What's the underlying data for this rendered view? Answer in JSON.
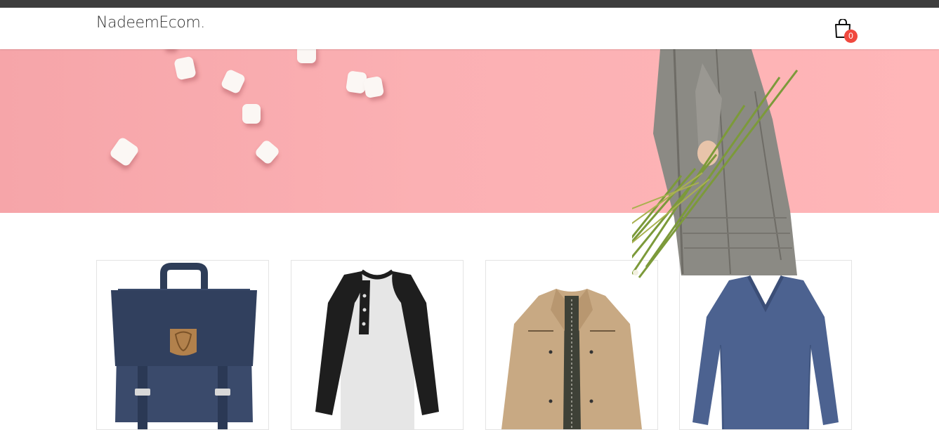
{
  "header": {
    "brand": "NadeemEcom.",
    "cart_count": "0"
  },
  "icons": {
    "cart": "shopping-bag-icon"
  },
  "colors": {
    "top_strip": "#3d3d3d",
    "hero_background": "#fbb0b3",
    "cart_badge": "#f0483e"
  },
  "products": [
    {
      "image": "navy-backpack"
    },
    {
      "image": "raglan-henley-shirt"
    },
    {
      "image": "tan-jacket"
    },
    {
      "image": "blue-vneck-sweater"
    }
  ]
}
